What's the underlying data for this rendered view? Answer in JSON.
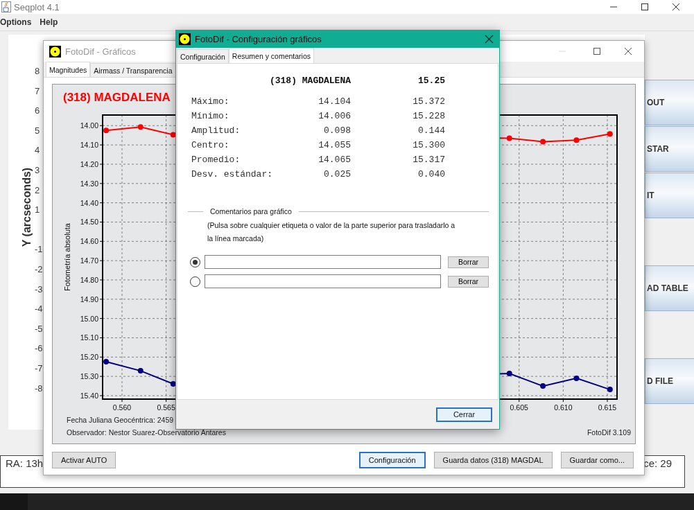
{
  "main_window": {
    "title": "Seqplot 4.1",
    "menu": [
      "Options",
      "Help"
    ],
    "plot": {
      "axis_title": "Y (arcseconds)",
      "tick_labels": [
        "8",
        "7",
        "6",
        "5",
        "4",
        "3",
        "2",
        "1",
        "-1",
        "-2",
        "-3",
        "-4",
        "-5",
        "-6",
        "-7",
        "-8"
      ]
    },
    "side_buttons": [
      "OUT",
      "STAR",
      "IT",
      "AD TABLE",
      "D FILE"
    ],
    "status": {
      "left": "RA: 13h",
      "right": "ce: 29"
    }
  },
  "graph_window": {
    "title": "FotoDif - Gráficos",
    "tabs": [
      {
        "label": "Magnitudes",
        "selected": true
      },
      {
        "label": "Airmass / Transparencia",
        "selected": false
      }
    ],
    "chart": {
      "chart_data": {
        "type": "line",
        "title": "(318) MAGDALENA",
        "ylabel": "Fotometría absoluta",
        "grid": true,
        "x": [
          0.5582,
          0.5621,
          0.5658,
          0.6039,
          0.6077,
          0.6115,
          0.6153
        ],
        "series": [
          {
            "color": "#ff0000",
            "marker": "circle",
            "values": [
              14.025,
              14.007,
              14.047,
              14.065,
              14.083,
              14.075,
              14.043
            ]
          },
          {
            "color": "#000080",
            "marker": "circle",
            "values": [
              15.224,
              15.271,
              15.339,
              15.285,
              15.35,
              15.31,
              15.368
            ]
          }
        ],
        "xlim": [
          0.5578,
          0.6161
        ],
        "ylim": [
          15.418,
          13.945
        ],
        "xticks": [
          {
            "value": 0.56,
            "label": "0.560"
          },
          {
            "value": 0.565,
            "label": "0.565"
          },
          {
            "value": 0.605,
            "label": "0.605"
          },
          {
            "value": 0.61,
            "label": "0.610"
          },
          {
            "value": 0.615,
            "label": "0.615"
          }
        ],
        "yticks": [
          {
            "value": 14,
            "label": "14.00"
          },
          {
            "value": 14.1,
            "label": "14.10"
          },
          {
            "value": 14.2,
            "label": "14.20"
          },
          {
            "value": 14.3,
            "label": "14.30"
          },
          {
            "value": 14.4,
            "label": "14.40"
          },
          {
            "value": 14.5,
            "label": "14.50"
          },
          {
            "value": 14.6,
            "label": "14.60"
          },
          {
            "value": 14.7,
            "label": "14.70"
          },
          {
            "value": 14.8,
            "label": "14.80"
          },
          {
            "value": 14.9,
            "label": "14.90"
          },
          {
            "value": 15,
            "label": "15.00"
          },
          {
            "value": 15.1,
            "label": "15.10"
          },
          {
            "value": 15.2,
            "label": "15.20"
          },
          {
            "value": 15.3,
            "label": "15.30"
          },
          {
            "value": 15.4,
            "label": "15.40"
          }
        ]
      },
      "date": "Fecha Juliana Geocéntrica: 2459",
      "observer": "Observador: Nestor Suarez-Observatorio Antares",
      "version": "FotoDif 3.109"
    },
    "buttons": [
      {
        "label": "Activar AUTO",
        "focused": false
      },
      {
        "label": "Configuración",
        "focused": true
      },
      {
        "label": "Guarda datos (318) MAGDAL",
        "focused": false
      },
      {
        "label": "Guardar como...",
        "focused": false
      }
    ]
  },
  "dialog": {
    "title": "FotoDif - Configuración gráficos",
    "tabs": [
      {
        "label": "Configuración",
        "selected": false
      },
      {
        "label": "Resumen y comentarios",
        "selected": true
      }
    ],
    "summary": {
      "name": "(318) MAGDALENA",
      "value": "15.25",
      "rows": [
        {
          "label": "Máximo:",
          "a": "14.104",
          "b": "15.372"
        },
        {
          "label": "Mínimo:",
          "a": "14.006",
          "b": "15.228"
        },
        {
          "label": "Amplitud:",
          "a": "0.098",
          "b": "0.144"
        },
        {
          "label": "Centro:",
          "a": "14.055",
          "b": "15.300"
        },
        {
          "label": "Promedio:",
          "a": "14.065",
          "b": "15.317"
        },
        {
          "label": "Desv. estándar:",
          "a": "0.025",
          "b": "0.040"
        }
      ]
    },
    "comments_title": "Comentarios para gráfico",
    "comments_help": "(Pulsa sobre cualquier etiqueta o valor de la parte superior para trasladarlo a la línea marcada)",
    "comments": [
      {
        "selected": true,
        "button": "Borrar"
      },
      {
        "selected": false,
        "button": "Borrar"
      }
    ],
    "close_button": {
      "label": "Cerrar",
      "focused": true
    }
  }
}
